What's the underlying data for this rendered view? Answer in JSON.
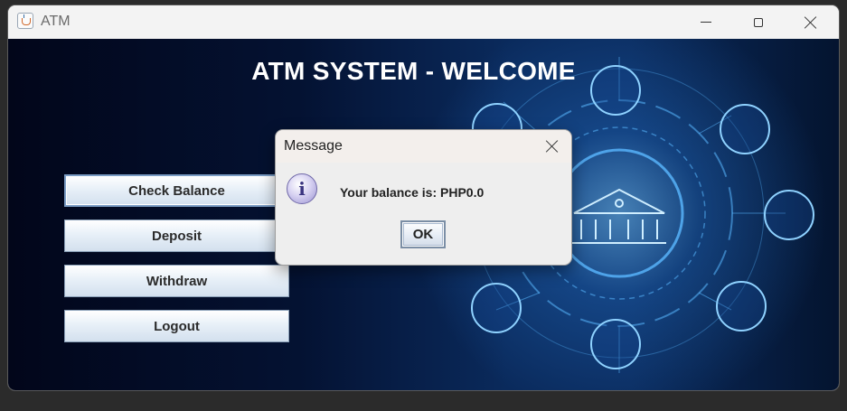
{
  "window": {
    "title": "ATM",
    "controls": [
      "minimize-icon",
      "maximize-icon",
      "close-icon"
    ]
  },
  "main": {
    "heading": "ATM SYSTEM - WELCOME",
    "buttons": [
      {
        "label": "Check Balance"
      },
      {
        "label": "Deposit"
      },
      {
        "label": "Withdraw"
      },
      {
        "label": "Logout"
      }
    ]
  },
  "dialog": {
    "title": "Message",
    "icon": "info-icon",
    "message": "Your balance is: PHP0.0",
    "ok_label": "OK"
  },
  "colors": {
    "heading_text": "#ffffff",
    "background_dark": "#041232",
    "background_glow": "#2878d2"
  }
}
